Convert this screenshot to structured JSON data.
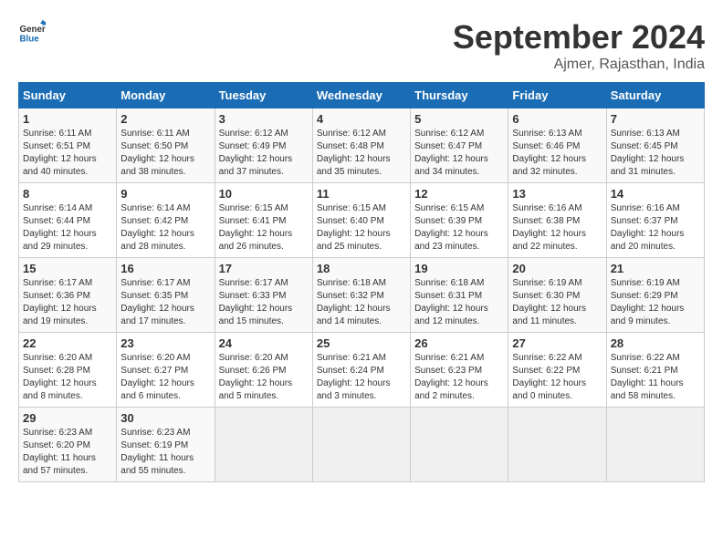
{
  "header": {
    "logo_line1": "General",
    "logo_line2": "Blue",
    "month_title": "September 2024",
    "location": "Ajmer, Rajasthan, India"
  },
  "days_of_week": [
    "Sunday",
    "Monday",
    "Tuesday",
    "Wednesday",
    "Thursday",
    "Friday",
    "Saturday"
  ],
  "weeks": [
    [
      {
        "day": "1",
        "sunrise": "Sunrise: 6:11 AM",
        "sunset": "Sunset: 6:51 PM",
        "daylight": "Daylight: 12 hours and 40 minutes."
      },
      {
        "day": "2",
        "sunrise": "Sunrise: 6:11 AM",
        "sunset": "Sunset: 6:50 PM",
        "daylight": "Daylight: 12 hours and 38 minutes."
      },
      {
        "day": "3",
        "sunrise": "Sunrise: 6:12 AM",
        "sunset": "Sunset: 6:49 PM",
        "daylight": "Daylight: 12 hours and 37 minutes."
      },
      {
        "day": "4",
        "sunrise": "Sunrise: 6:12 AM",
        "sunset": "Sunset: 6:48 PM",
        "daylight": "Daylight: 12 hours and 35 minutes."
      },
      {
        "day": "5",
        "sunrise": "Sunrise: 6:12 AM",
        "sunset": "Sunset: 6:47 PM",
        "daylight": "Daylight: 12 hours and 34 minutes."
      },
      {
        "day": "6",
        "sunrise": "Sunrise: 6:13 AM",
        "sunset": "Sunset: 6:46 PM",
        "daylight": "Daylight: 12 hours and 32 minutes."
      },
      {
        "day": "7",
        "sunrise": "Sunrise: 6:13 AM",
        "sunset": "Sunset: 6:45 PM",
        "daylight": "Daylight: 12 hours and 31 minutes."
      }
    ],
    [
      {
        "day": "8",
        "sunrise": "Sunrise: 6:14 AM",
        "sunset": "Sunset: 6:44 PM",
        "daylight": "Daylight: 12 hours and 29 minutes."
      },
      {
        "day": "9",
        "sunrise": "Sunrise: 6:14 AM",
        "sunset": "Sunset: 6:42 PM",
        "daylight": "Daylight: 12 hours and 28 minutes."
      },
      {
        "day": "10",
        "sunrise": "Sunrise: 6:15 AM",
        "sunset": "Sunset: 6:41 PM",
        "daylight": "Daylight: 12 hours and 26 minutes."
      },
      {
        "day": "11",
        "sunrise": "Sunrise: 6:15 AM",
        "sunset": "Sunset: 6:40 PM",
        "daylight": "Daylight: 12 hours and 25 minutes."
      },
      {
        "day": "12",
        "sunrise": "Sunrise: 6:15 AM",
        "sunset": "Sunset: 6:39 PM",
        "daylight": "Daylight: 12 hours and 23 minutes."
      },
      {
        "day": "13",
        "sunrise": "Sunrise: 6:16 AM",
        "sunset": "Sunset: 6:38 PM",
        "daylight": "Daylight: 12 hours and 22 minutes."
      },
      {
        "day": "14",
        "sunrise": "Sunrise: 6:16 AM",
        "sunset": "Sunset: 6:37 PM",
        "daylight": "Daylight: 12 hours and 20 minutes."
      }
    ],
    [
      {
        "day": "15",
        "sunrise": "Sunrise: 6:17 AM",
        "sunset": "Sunset: 6:36 PM",
        "daylight": "Daylight: 12 hours and 19 minutes."
      },
      {
        "day": "16",
        "sunrise": "Sunrise: 6:17 AM",
        "sunset": "Sunset: 6:35 PM",
        "daylight": "Daylight: 12 hours and 17 minutes."
      },
      {
        "day": "17",
        "sunrise": "Sunrise: 6:17 AM",
        "sunset": "Sunset: 6:33 PM",
        "daylight": "Daylight: 12 hours and 15 minutes."
      },
      {
        "day": "18",
        "sunrise": "Sunrise: 6:18 AM",
        "sunset": "Sunset: 6:32 PM",
        "daylight": "Daylight: 12 hours and 14 minutes."
      },
      {
        "day": "19",
        "sunrise": "Sunrise: 6:18 AM",
        "sunset": "Sunset: 6:31 PM",
        "daylight": "Daylight: 12 hours and 12 minutes."
      },
      {
        "day": "20",
        "sunrise": "Sunrise: 6:19 AM",
        "sunset": "Sunset: 6:30 PM",
        "daylight": "Daylight: 12 hours and 11 minutes."
      },
      {
        "day": "21",
        "sunrise": "Sunrise: 6:19 AM",
        "sunset": "Sunset: 6:29 PM",
        "daylight": "Daylight: 12 hours and 9 minutes."
      }
    ],
    [
      {
        "day": "22",
        "sunrise": "Sunrise: 6:20 AM",
        "sunset": "Sunset: 6:28 PM",
        "daylight": "Daylight: 12 hours and 8 minutes."
      },
      {
        "day": "23",
        "sunrise": "Sunrise: 6:20 AM",
        "sunset": "Sunset: 6:27 PM",
        "daylight": "Daylight: 12 hours and 6 minutes."
      },
      {
        "day": "24",
        "sunrise": "Sunrise: 6:20 AM",
        "sunset": "Sunset: 6:26 PM",
        "daylight": "Daylight: 12 hours and 5 minutes."
      },
      {
        "day": "25",
        "sunrise": "Sunrise: 6:21 AM",
        "sunset": "Sunset: 6:24 PM",
        "daylight": "Daylight: 12 hours and 3 minutes."
      },
      {
        "day": "26",
        "sunrise": "Sunrise: 6:21 AM",
        "sunset": "Sunset: 6:23 PM",
        "daylight": "Daylight: 12 hours and 2 minutes."
      },
      {
        "day": "27",
        "sunrise": "Sunrise: 6:22 AM",
        "sunset": "Sunset: 6:22 PM",
        "daylight": "Daylight: 12 hours and 0 minutes."
      },
      {
        "day": "28",
        "sunrise": "Sunrise: 6:22 AM",
        "sunset": "Sunset: 6:21 PM",
        "daylight": "Daylight: 11 hours and 58 minutes."
      }
    ],
    [
      {
        "day": "29",
        "sunrise": "Sunrise: 6:23 AM",
        "sunset": "Sunset: 6:20 PM",
        "daylight": "Daylight: 11 hours and 57 minutes."
      },
      {
        "day": "30",
        "sunrise": "Sunrise: 6:23 AM",
        "sunset": "Sunset: 6:19 PM",
        "daylight": "Daylight: 11 hours and 55 minutes."
      },
      null,
      null,
      null,
      null,
      null
    ]
  ]
}
